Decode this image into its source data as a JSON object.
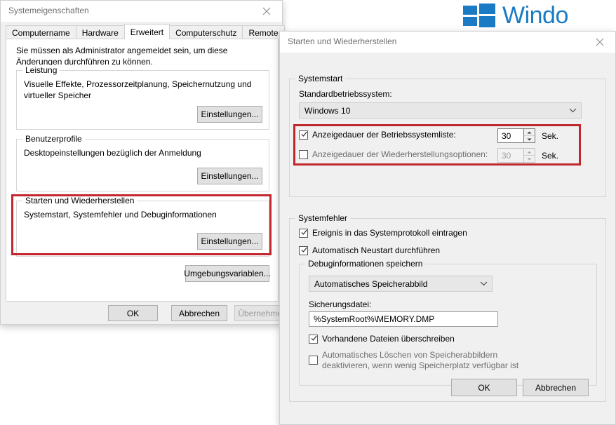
{
  "banner": {
    "product_word": "Windo",
    "logo_color": "#1a7bc4"
  },
  "accent": {
    "highlight_red": "#c1272d"
  },
  "system_properties": {
    "title": "Systemeigenschaften",
    "close_icon": "close-icon",
    "tabs": [
      {
        "label": "Computername",
        "active": false
      },
      {
        "label": "Hardware",
        "active": false
      },
      {
        "label": "Erweitert",
        "active": true
      },
      {
        "label": "Computerschutz",
        "active": false
      },
      {
        "label": "Remote",
        "active": false
      }
    ],
    "admin_note": "Sie müssen als Administrator angemeldet sein, um diese Änderungen durchführen zu können.",
    "groups": [
      {
        "legend": "Leistung",
        "description": "Visuelle Effekte, Prozessorzeitplanung, Speichernutzung und virtueller Speicher",
        "button": "Einstellungen..."
      },
      {
        "legend": "Benutzerprofile",
        "description": "Desktopeinstellungen bezüglich der Anmeldung",
        "button": "Einstellungen..."
      },
      {
        "legend": "Starten und Wiederherstellen",
        "description": "Systemstart, Systemfehler und Debuginformationen",
        "button": "Einstellungen...",
        "highlighted": true
      }
    ],
    "env_button": "Umgebungsvariablen...",
    "footer_buttons": [
      {
        "label": "OK",
        "disabled": false
      },
      {
        "label": "Abbrechen",
        "disabled": false
      },
      {
        "label": "Übernehmen",
        "disabled": true
      }
    ]
  },
  "startup_recovery": {
    "title": "Starten und Wiederherstellen",
    "close_icon": "close-icon",
    "systemstart": {
      "legend": "Systemstart",
      "default_os_label": "Standardbetriebssystem:",
      "default_os_value": "Windows 10",
      "timeouts": [
        {
          "label": "Anzeigedauer der Betriebssystemliste:",
          "checked": true,
          "value": "30",
          "unit": "Sek.",
          "disabled": false
        },
        {
          "label": "Anzeigedauer der Wiederherstellungsoptionen:",
          "checked": false,
          "value": "30",
          "unit": "Sek.",
          "disabled": true
        }
      ],
      "highlighted": true
    },
    "systemfehler": {
      "legend": "Systemfehler",
      "options": [
        {
          "label": "Ereignis in das Systemprotokoll eintragen",
          "checked": true
        },
        {
          "label": "Automatisch Neustart durchführen",
          "checked": true
        }
      ],
      "debug_group": {
        "legend": "Debuginformationen speichern",
        "dump_type_value": "Automatisches Speicherabbild",
        "dump_file_label": "Sicherungsdatei:",
        "dump_file_value": "%SystemRoot%\\MEMORY.DMP",
        "options": [
          {
            "label": "Vorhandene Dateien überschreiben",
            "checked": true,
            "wrap": false
          },
          {
            "label": "Automatisches Löschen von Speicherabbildern deaktivieren, wenn wenig Speicherplatz verfügbar ist",
            "checked": false,
            "wrap": true
          }
        ]
      }
    },
    "footer_buttons": [
      {
        "label": "OK"
      },
      {
        "label": "Abbrechen"
      }
    ]
  }
}
